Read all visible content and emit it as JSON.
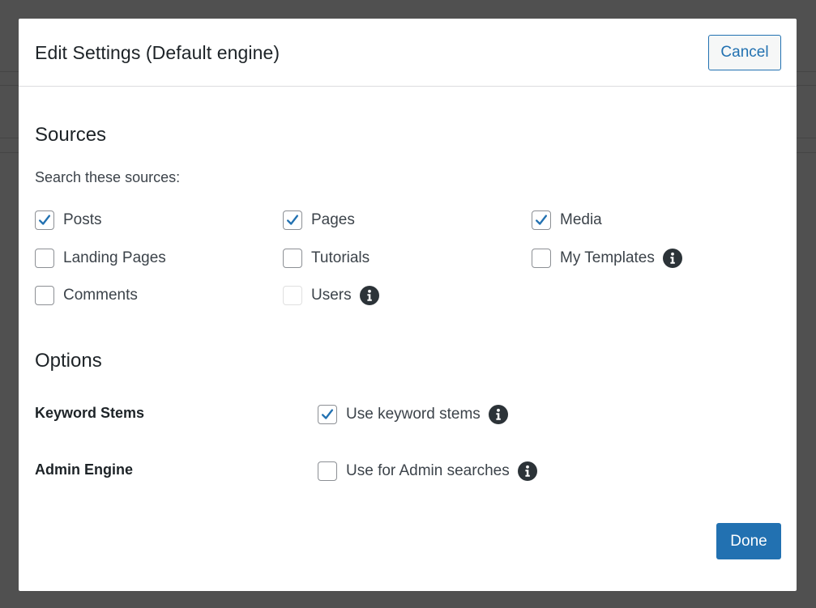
{
  "dialog": {
    "title": "Edit Settings (Default engine)",
    "cancel_label": "Cancel",
    "done_label": "Done"
  },
  "sources": {
    "heading": "Sources",
    "subheading": "Search these sources:",
    "items": [
      {
        "label": "Posts",
        "checked": true,
        "disabled": false,
        "info": false
      },
      {
        "label": "Pages",
        "checked": true,
        "disabled": false,
        "info": false
      },
      {
        "label": "Media",
        "checked": true,
        "disabled": false,
        "info": false
      },
      {
        "label": "Landing Pages",
        "checked": false,
        "disabled": false,
        "info": false
      },
      {
        "label": "Tutorials",
        "checked": false,
        "disabled": false,
        "info": false
      },
      {
        "label": "My Templates",
        "checked": false,
        "disabled": false,
        "info": true
      },
      {
        "label": "Comments",
        "checked": false,
        "disabled": false,
        "info": false
      },
      {
        "label": "Users",
        "checked": false,
        "disabled": true,
        "info": true
      }
    ]
  },
  "options": {
    "heading": "Options",
    "keyword_stems": {
      "label": "Keyword Stems",
      "checkbox_label": "Use keyword stems",
      "checked": true
    },
    "admin_engine": {
      "label": "Admin Engine",
      "checkbox_label": "Use for Admin searches",
      "checked": false
    }
  },
  "icons": {
    "info": "info-icon",
    "check": "checkmark-icon"
  },
  "colors": {
    "accent": "#2271b1",
    "check": "#2271b1",
    "info_icon": "#2c3338",
    "backdrop": "#505050"
  }
}
